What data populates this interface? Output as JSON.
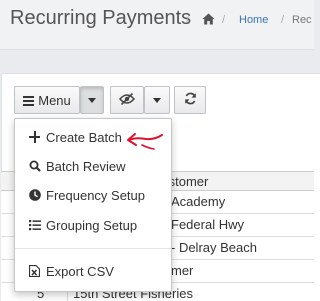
{
  "header": {
    "title": "Recurring Payments",
    "sep": "/",
    "home": "Home",
    "crumb": "Rec"
  },
  "toolbar": {
    "menu_label": "Menu"
  },
  "dropdown": {
    "items": [
      {
        "label": "Create Batch",
        "icon": "plus-icon"
      },
      {
        "label": "Batch Review",
        "icon": "search-icon"
      },
      {
        "label": "Frequency Setup",
        "icon": "clock-icon"
      },
      {
        "label": "Grouping Setup",
        "icon": "list-icon"
      },
      {
        "label": "Export CSV",
        "icon": "file-excel-icon"
      }
    ]
  },
  "table": {
    "headers": [
      "",
      "Customer"
    ],
    "rows": [
      {
        "col1": "",
        "customer": "Academy"
      },
      {
        "col1": "",
        "customer": "Federal Hwy"
      },
      {
        "col1": "",
        "customer": "- Delray Beach"
      },
      {
        "col1": "",
        "customer": "mer"
      },
      {
        "col1": "5",
        "customer": "15th Street Fisheries"
      }
    ]
  },
  "colors": {
    "link": "#3a73b5",
    "annotation_arrow": "#e0112b"
  }
}
